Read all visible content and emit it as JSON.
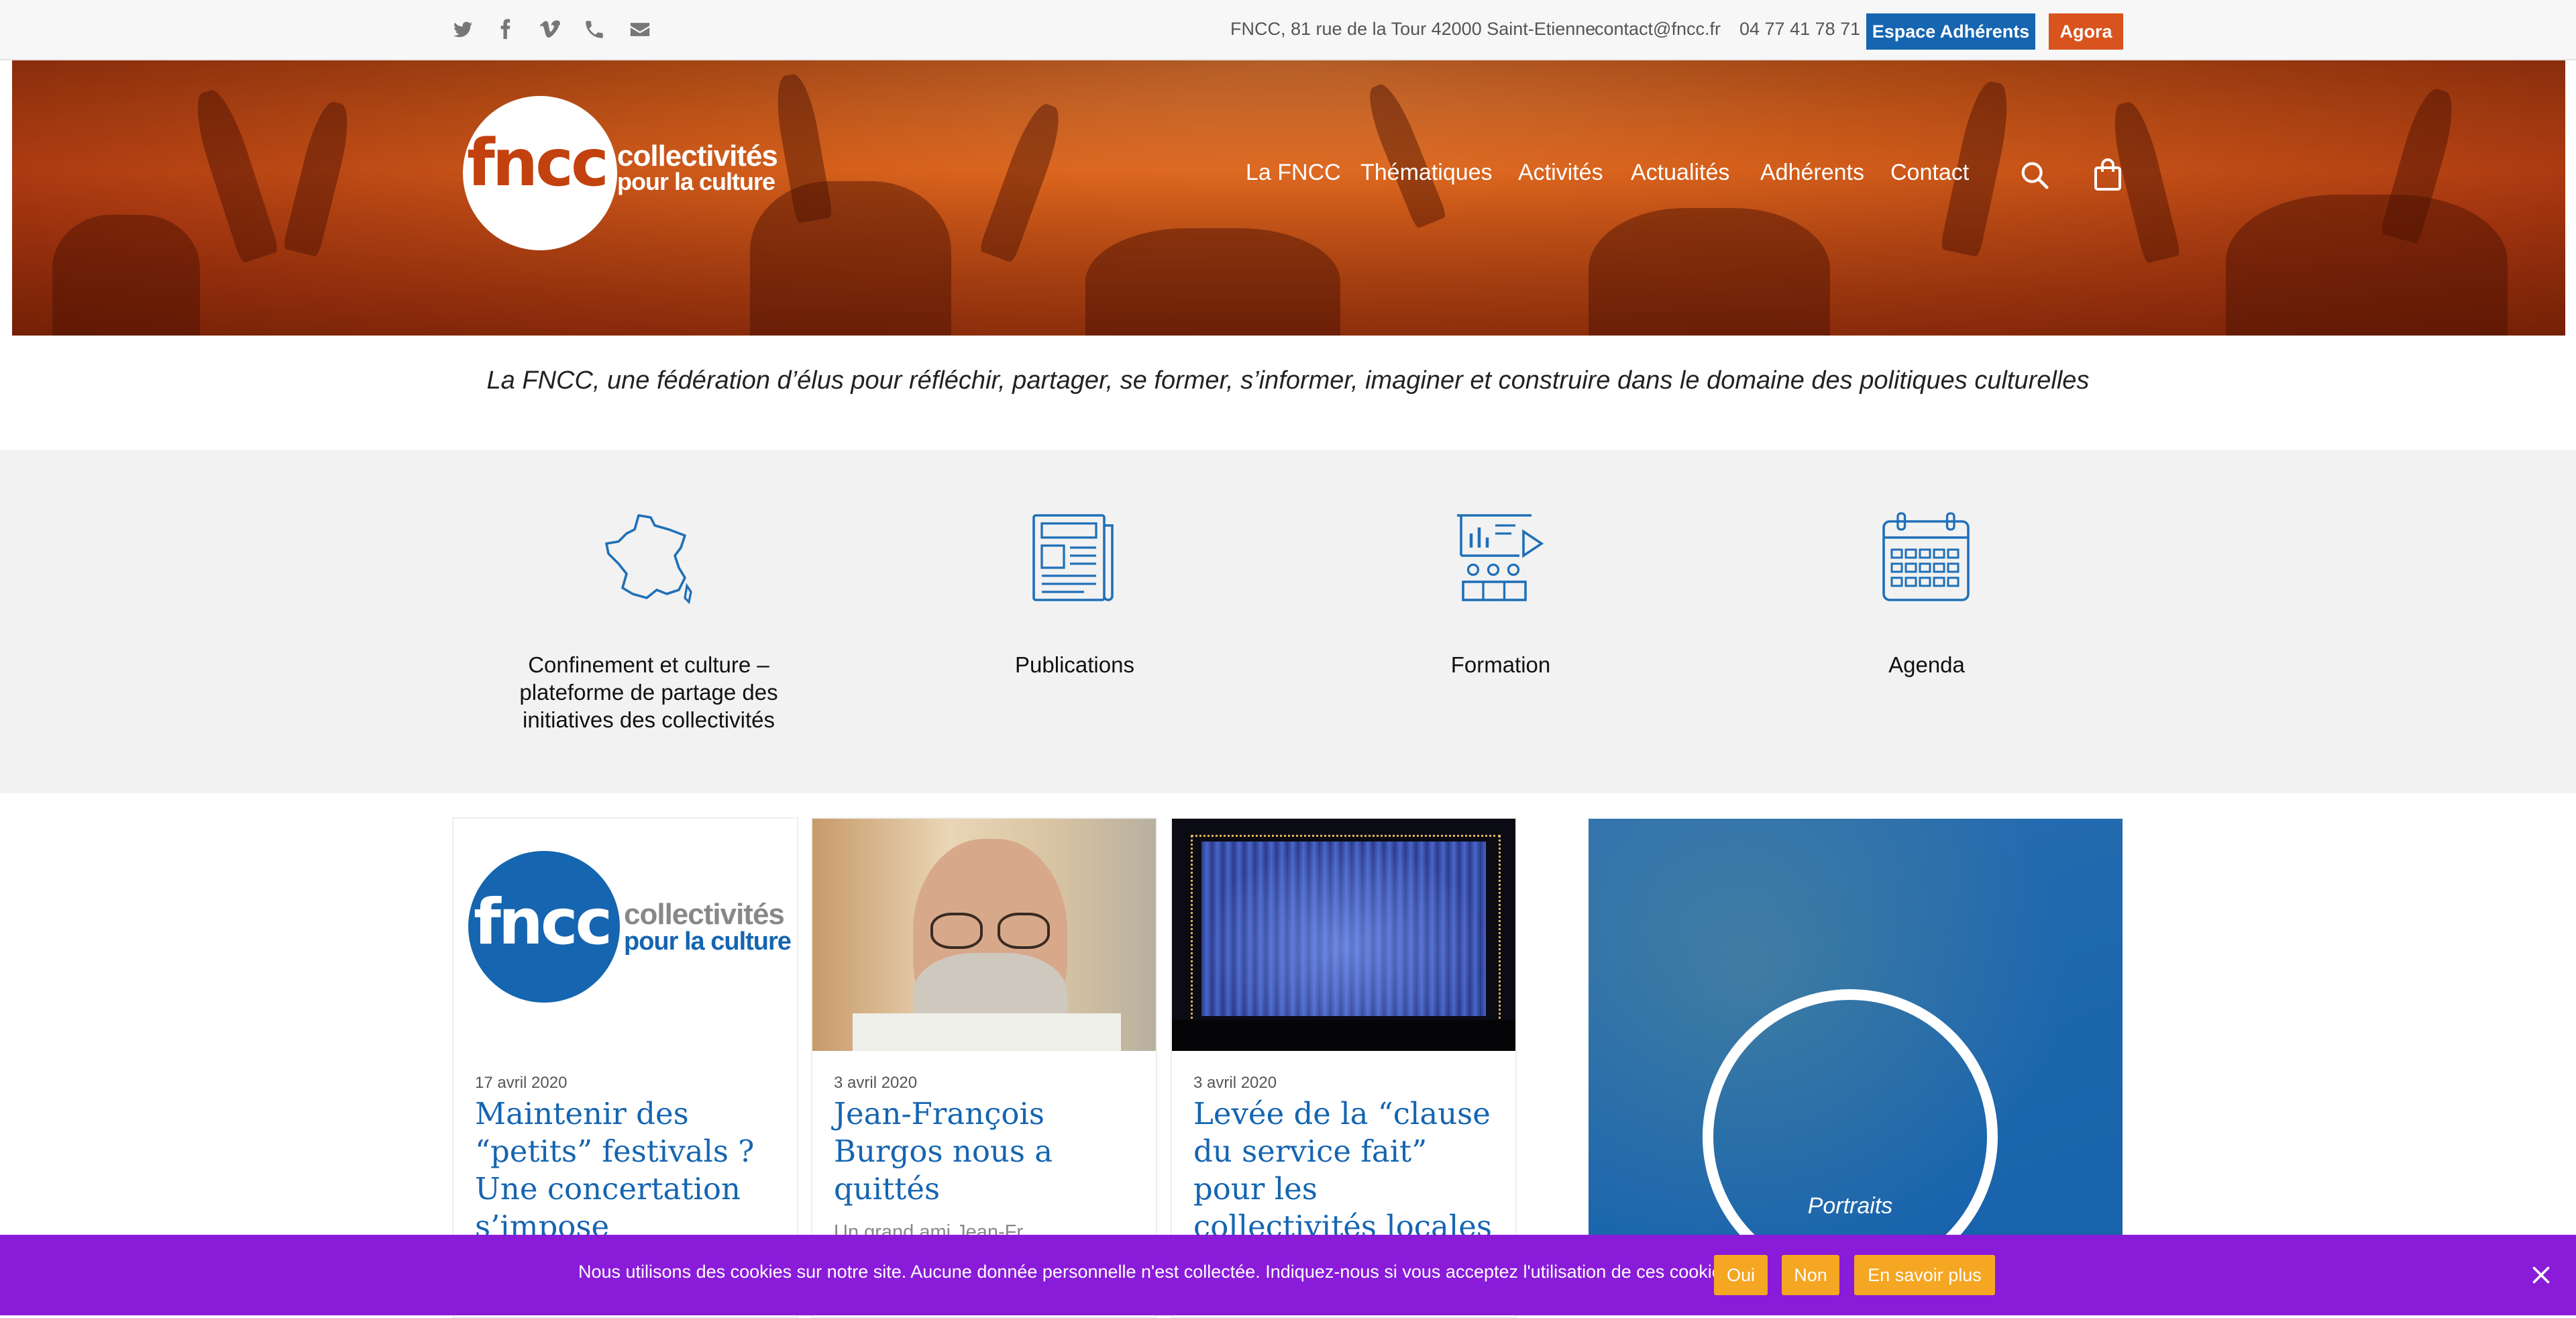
{
  "topbar": {
    "social": [
      "twitter-icon",
      "facebook-icon",
      "vimeo-icon",
      "phone-icon",
      "email-icon"
    ],
    "address": "FNCC, 81 rue de la Tour 42000 Saint-Etienne",
    "email": "contact@fncc.fr",
    "phone": "04 77 41 78 71",
    "espace_btn": "Espace Adhérents",
    "agora_btn": "Agora",
    "espace_color": "#1565b0",
    "agora_color": "#d9531e"
  },
  "logo": {
    "mark": "fncc",
    "line1": "collectivités",
    "line2": "pour la culture"
  },
  "nav": {
    "items": [
      "La FNCC",
      "Thématiques",
      "Activités",
      "Actualités",
      "Adhérents",
      "Contact"
    ]
  },
  "tagline": "La FNCC, une fédération d’élus pour réfléchir, partager, se former, s’informer, imaginer et construire dans le domaine des politiques culturelles",
  "features": [
    {
      "label": "Confinement et culture – plateforme de partage des initiatives des collectivités",
      "icon": "france-map-icon"
    },
    {
      "label": "Publications",
      "icon": "newspaper-icon"
    },
    {
      "label": "Formation",
      "icon": "presentation-icon"
    },
    {
      "label": "Agenda",
      "icon": "calendar-icon"
    }
  ],
  "posts": [
    {
      "date": "17 avril 2020",
      "title": "Maintenir des “petits” festivals ? Une concertation s’impose",
      "excerpt": ""
    },
    {
      "date": "3 avril 2020",
      "title": "Jean-François Burgos nous a quittés",
      "excerpt": "Un grand ami Jean-Fr…"
    },
    {
      "date": "3 avril 2020",
      "title": "Levée de la “clause du service fait” pour les collectivités locales : quel impact",
      "excerpt": ""
    }
  ],
  "portraits": {
    "label": "Portraits"
  },
  "cookie": {
    "text": "Nous utilisons des cookies sur notre site. Aucune donnée personnelle n'est collectée. Indiquez-nous si vous acceptez l'utilisation de ces cookies :",
    "yes": "Oui",
    "no": "Non",
    "more": "En savoir plus",
    "bar_color": "#8a1bd9",
    "button_color": "#f5a623"
  }
}
